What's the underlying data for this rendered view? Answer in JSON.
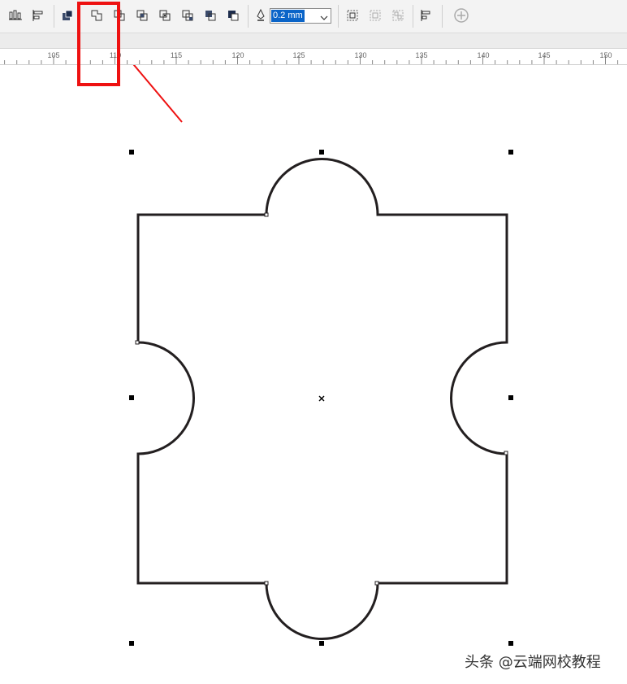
{
  "toolbar": {
    "outline_width": "0.2 mm",
    "icons": [
      "align-distribute-icon",
      "align-left-icon",
      "shaping-combine-icon",
      "weld-icon",
      "trim-icon",
      "intersect-icon",
      "simplify-icon",
      "front-minus-back-icon",
      "back-minus-front-icon",
      "create-boundary-icon",
      "outline-pen-icon",
      "group-icon",
      "ungroup-icon",
      "ungroup-all-icon",
      "align-objects-icon",
      "add-icon"
    ]
  },
  "ruler": {
    "labels": [
      "105",
      "110",
      "115",
      "120",
      "125",
      "130",
      "135",
      "140",
      "145",
      "150"
    ]
  },
  "annotation": {
    "highlight_color": "#ee1111"
  },
  "watermark": "头条 @云端网校教程"
}
